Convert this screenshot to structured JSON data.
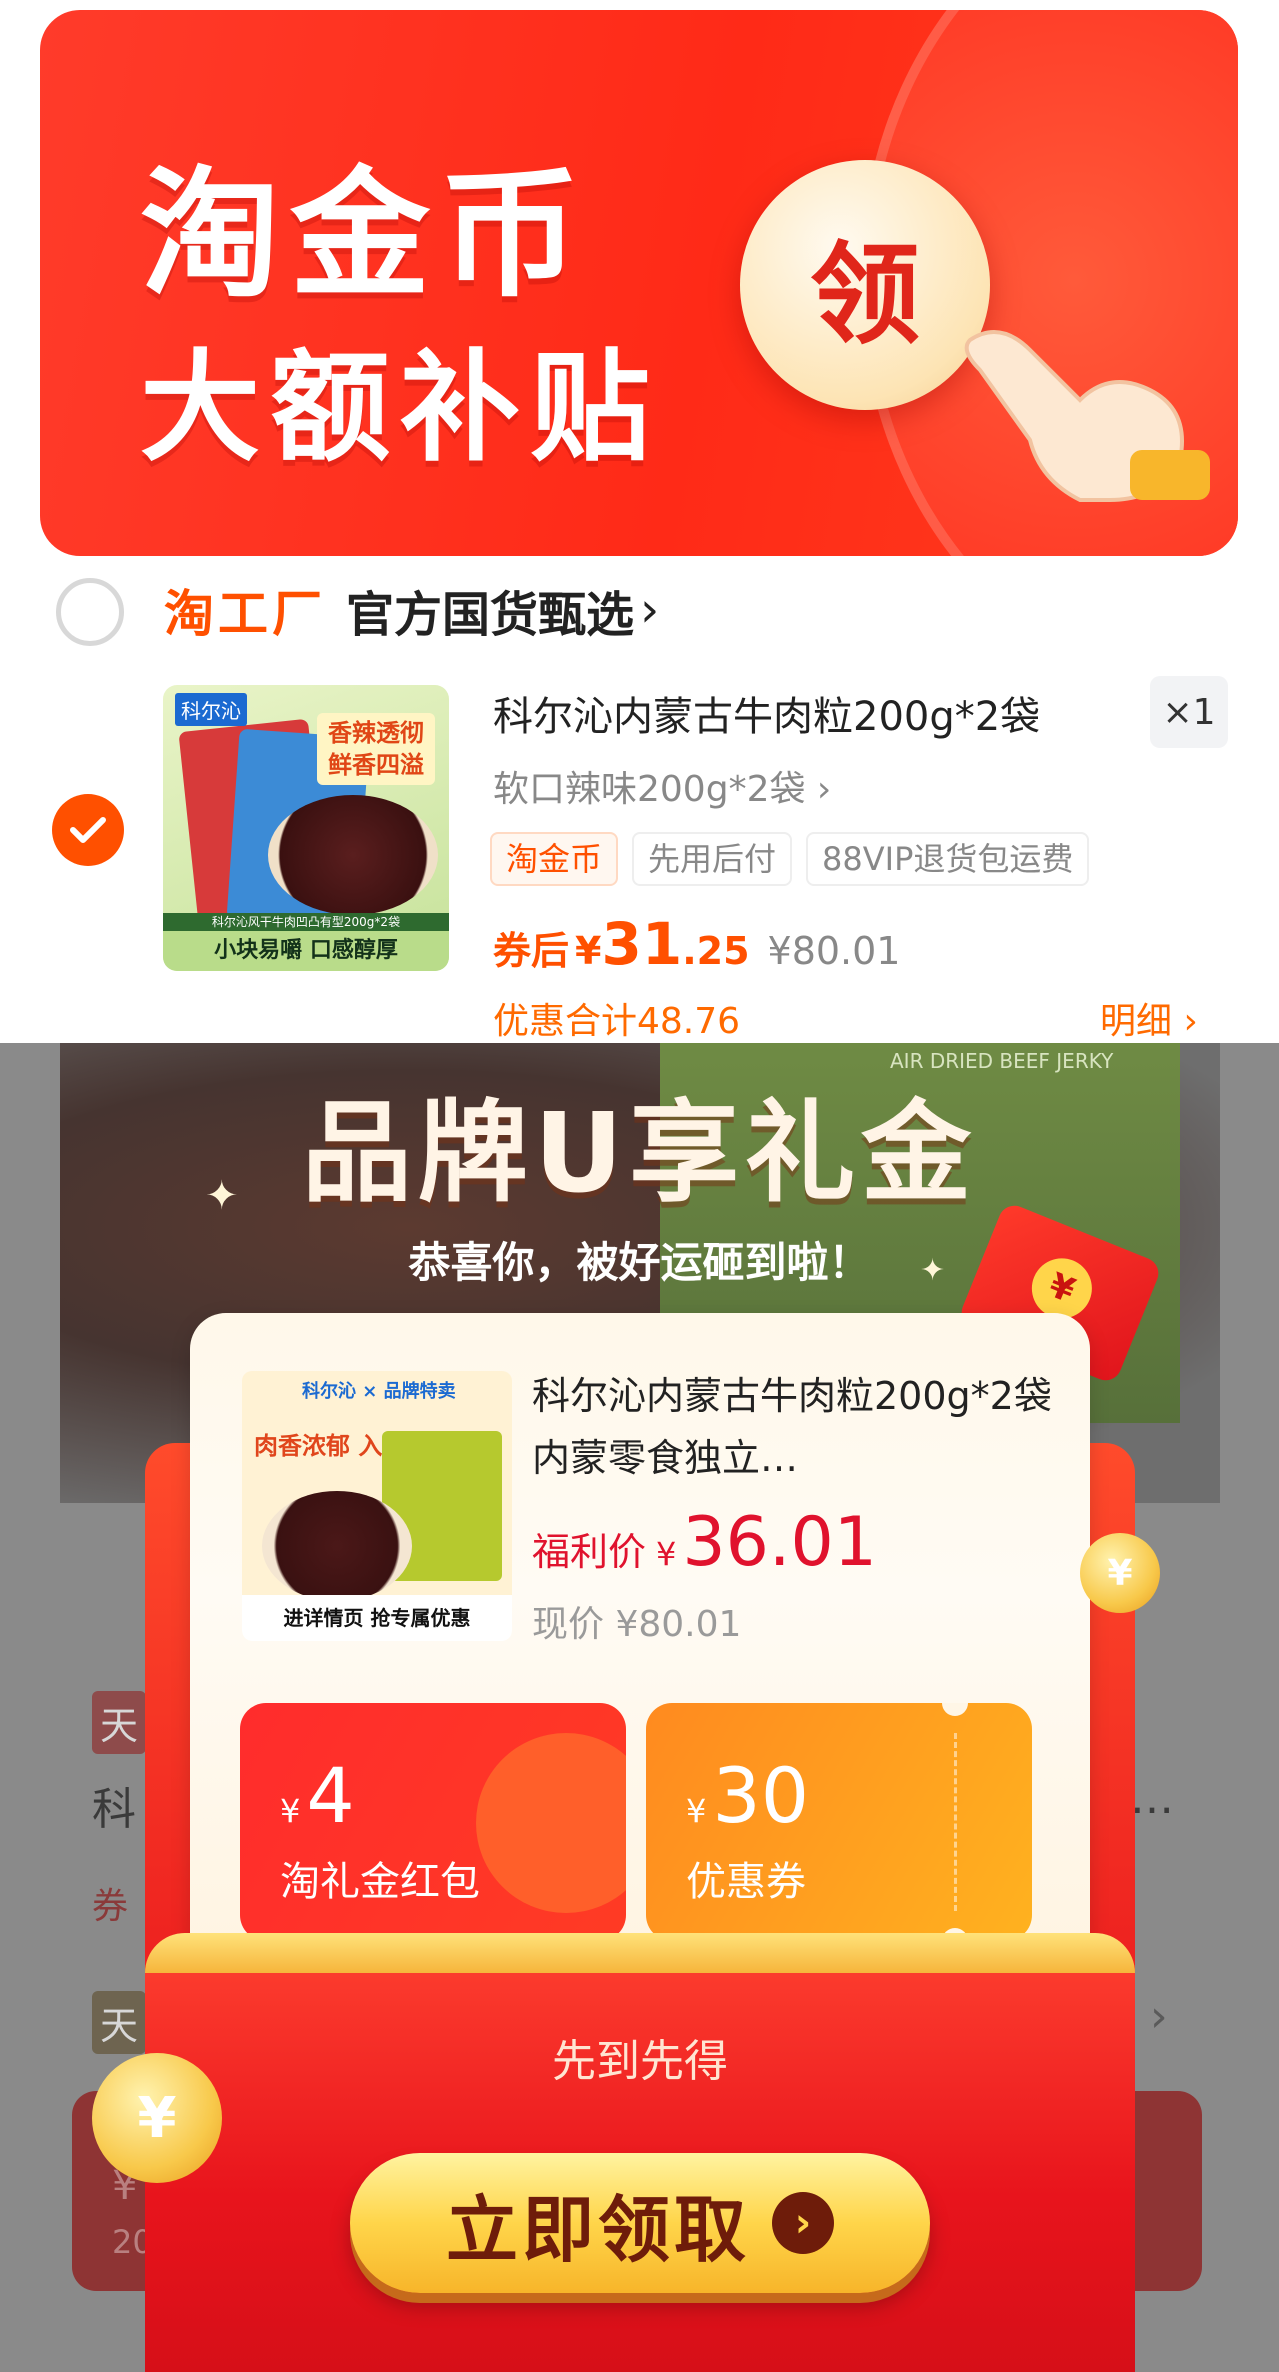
{
  "banner": {
    "line1": "淘金币",
    "line2": "大额补贴",
    "claim_glyph": "领"
  },
  "shop": {
    "logo": "淘工厂",
    "name": "官方国货甄选",
    "chevron": "›"
  },
  "product_image": {
    "brand": "科尔沁",
    "tag": "香辣透彻 鲜香四溢",
    "strip": "科尔沁风干牛肉凹凸有型200g*2袋",
    "caption": "小块易嚼 口感醇厚"
  },
  "cart_item": {
    "title": "科尔沁内蒙古牛肉粒200g*2袋",
    "quantity": "×1",
    "spec": "软口辣味200g*2袋 ›",
    "tags": [
      "淘金币",
      "先用后付",
      "88VIP退货包运费"
    ],
    "price_label": "券后",
    "price_yen": "¥",
    "price_int": "31",
    "price_dec": ".25",
    "original_price": "¥80.01",
    "discount_total": "优惠合计48.76",
    "detail_link": "明细 ›"
  },
  "background_page": {
    "jerky_label": "AIR DRIED BEEF JERKY",
    "chip1": "天",
    "text1": "科",
    "text2": "券",
    "chip2": "天",
    "ellipsis": "…",
    "chevron": "›",
    "price_fragment": "¥",
    "num_fragment": "20"
  },
  "modal": {
    "title": "品牌U享礼金",
    "subtitle": "恭喜你，被好运砸到啦！",
    "product_image": {
      "logo": "科尔沁 × 品牌特卖",
      "label": "肉香浓郁 入肌入理",
      "caption": "进详情页 抢专属优惠"
    },
    "product_title": "科尔沁内蒙古牛肉粒200g*2袋内蒙零食独立…",
    "welfare_label": "福利价",
    "welfare_yen": "¥",
    "welfare_price": "36.01",
    "current_price": "现价 ¥80.01",
    "coupons": [
      {
        "yen": "¥",
        "amount": "4",
        "name": "淘礼金红包"
      },
      {
        "yen": "¥",
        "amount": "30",
        "name": "优惠券"
      }
    ],
    "first_come": "先到先得",
    "cta_label": "立即领取",
    "cta_arrow": "›",
    "coin_glyph": "¥"
  },
  "colors": {
    "brand_orange": "#ff5000",
    "banner_red": "#ff2a17",
    "welfare_red": "#e0122d",
    "cta_gold": "#ffd54a"
  }
}
